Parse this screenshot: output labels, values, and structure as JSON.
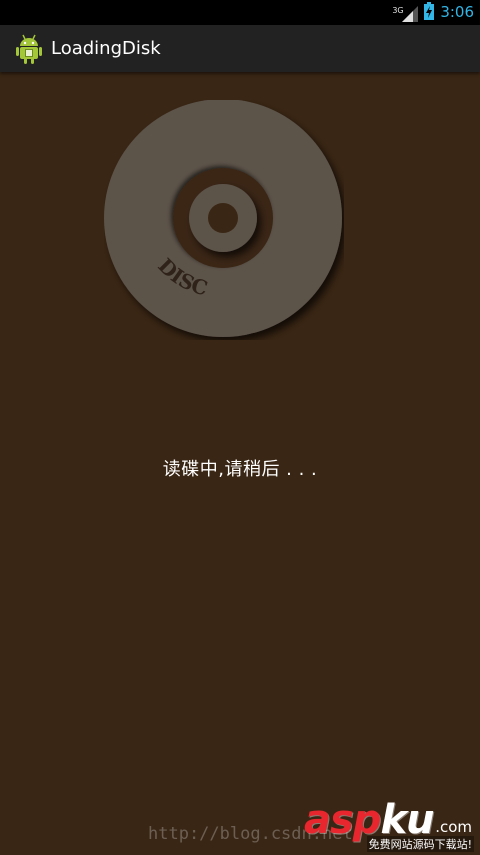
{
  "status_bar": {
    "network_type": "3G",
    "time": "3:06",
    "accent_color": "#33b5e5"
  },
  "action_bar": {
    "app_icon": "android-robot-icon",
    "title": "LoadingDisk"
  },
  "disc": {
    "label": "DISC",
    "icon": "disc-icon"
  },
  "loading": {
    "message": "读碟中,请稍后 . . ."
  },
  "watermark": {
    "url": "http://blog.csdn.net/",
    "brand_asp": "asp",
    "brand_ku": "ku",
    "tld": ".com",
    "slogan": "免费网站源码下载站!"
  },
  "colors": {
    "background": "#3a2614",
    "disc": "#5b524a",
    "disc_groove": "#3a2614",
    "action_bar": "#222222"
  }
}
